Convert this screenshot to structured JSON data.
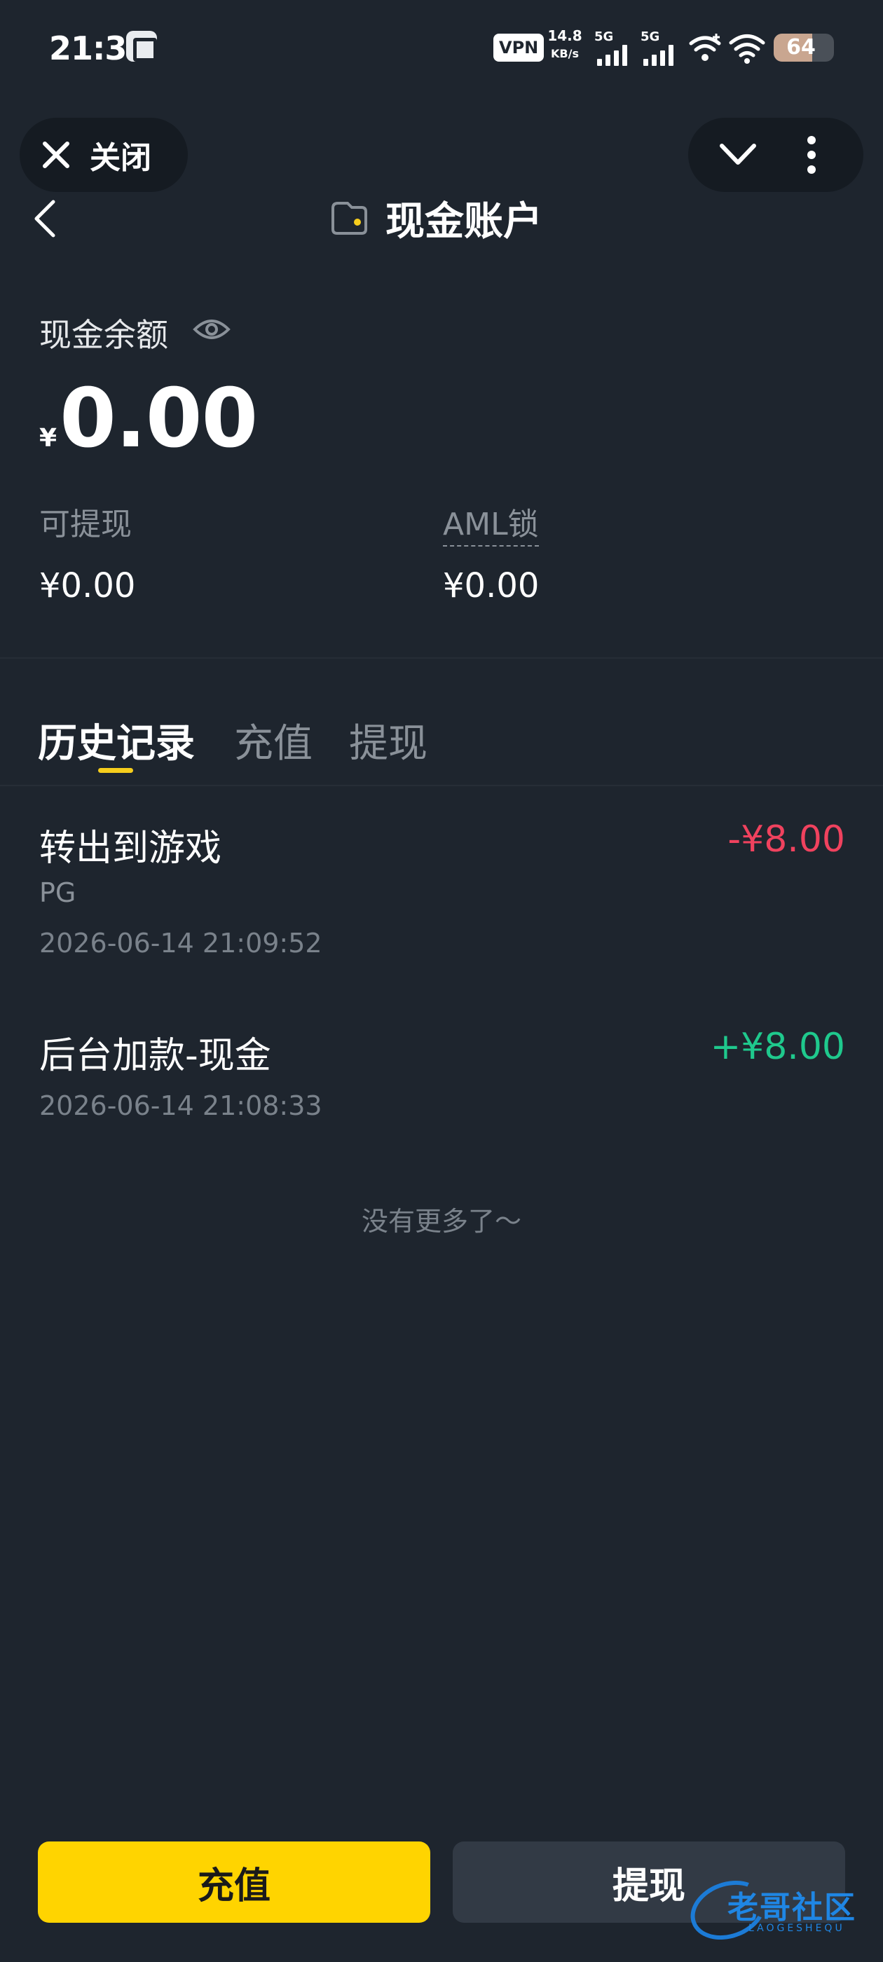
{
  "status_bar": {
    "time": "21:31",
    "vpn": "VPN",
    "net_speed_value": "14.8",
    "net_speed_unit": "KB/s",
    "sim1": "5G",
    "sim2": "5G",
    "battery": "64",
    "battery_level": 0.64
  },
  "capsule": {
    "close_label": "关闭"
  },
  "header": {
    "title": "现金账户"
  },
  "balance": {
    "label": "现金余额",
    "currency": "¥",
    "amount": "0.00",
    "withdrawable_label": "可提现",
    "withdrawable_value": "¥0.00",
    "aml_label": "AML锁",
    "aml_value": "¥0.00"
  },
  "tabs": [
    {
      "label": "历史记录",
      "active": true
    },
    {
      "label": "充值",
      "active": false
    },
    {
      "label": "提现",
      "active": false
    }
  ],
  "transactions": [
    {
      "title": "转出到游戏",
      "sub": "PG",
      "date": "2026-06-14 21:09:52",
      "amount": "-¥8.00",
      "type": "out"
    },
    {
      "title": "后台加款-现金",
      "sub": "",
      "date": "2026-06-14 21:08:33",
      "amount": "+¥8.00",
      "type": "in"
    }
  ],
  "list_end": "没有更多了〜",
  "actions": {
    "deposit": "充值",
    "withdraw": "提现"
  },
  "watermark": {
    "text": "老哥社区",
    "sub": "LAOGESHEQU"
  },
  "colors": {
    "background": "#1e252e",
    "accent": "#ffd400",
    "negative": "#f0425e",
    "positive": "#1fc98d"
  }
}
